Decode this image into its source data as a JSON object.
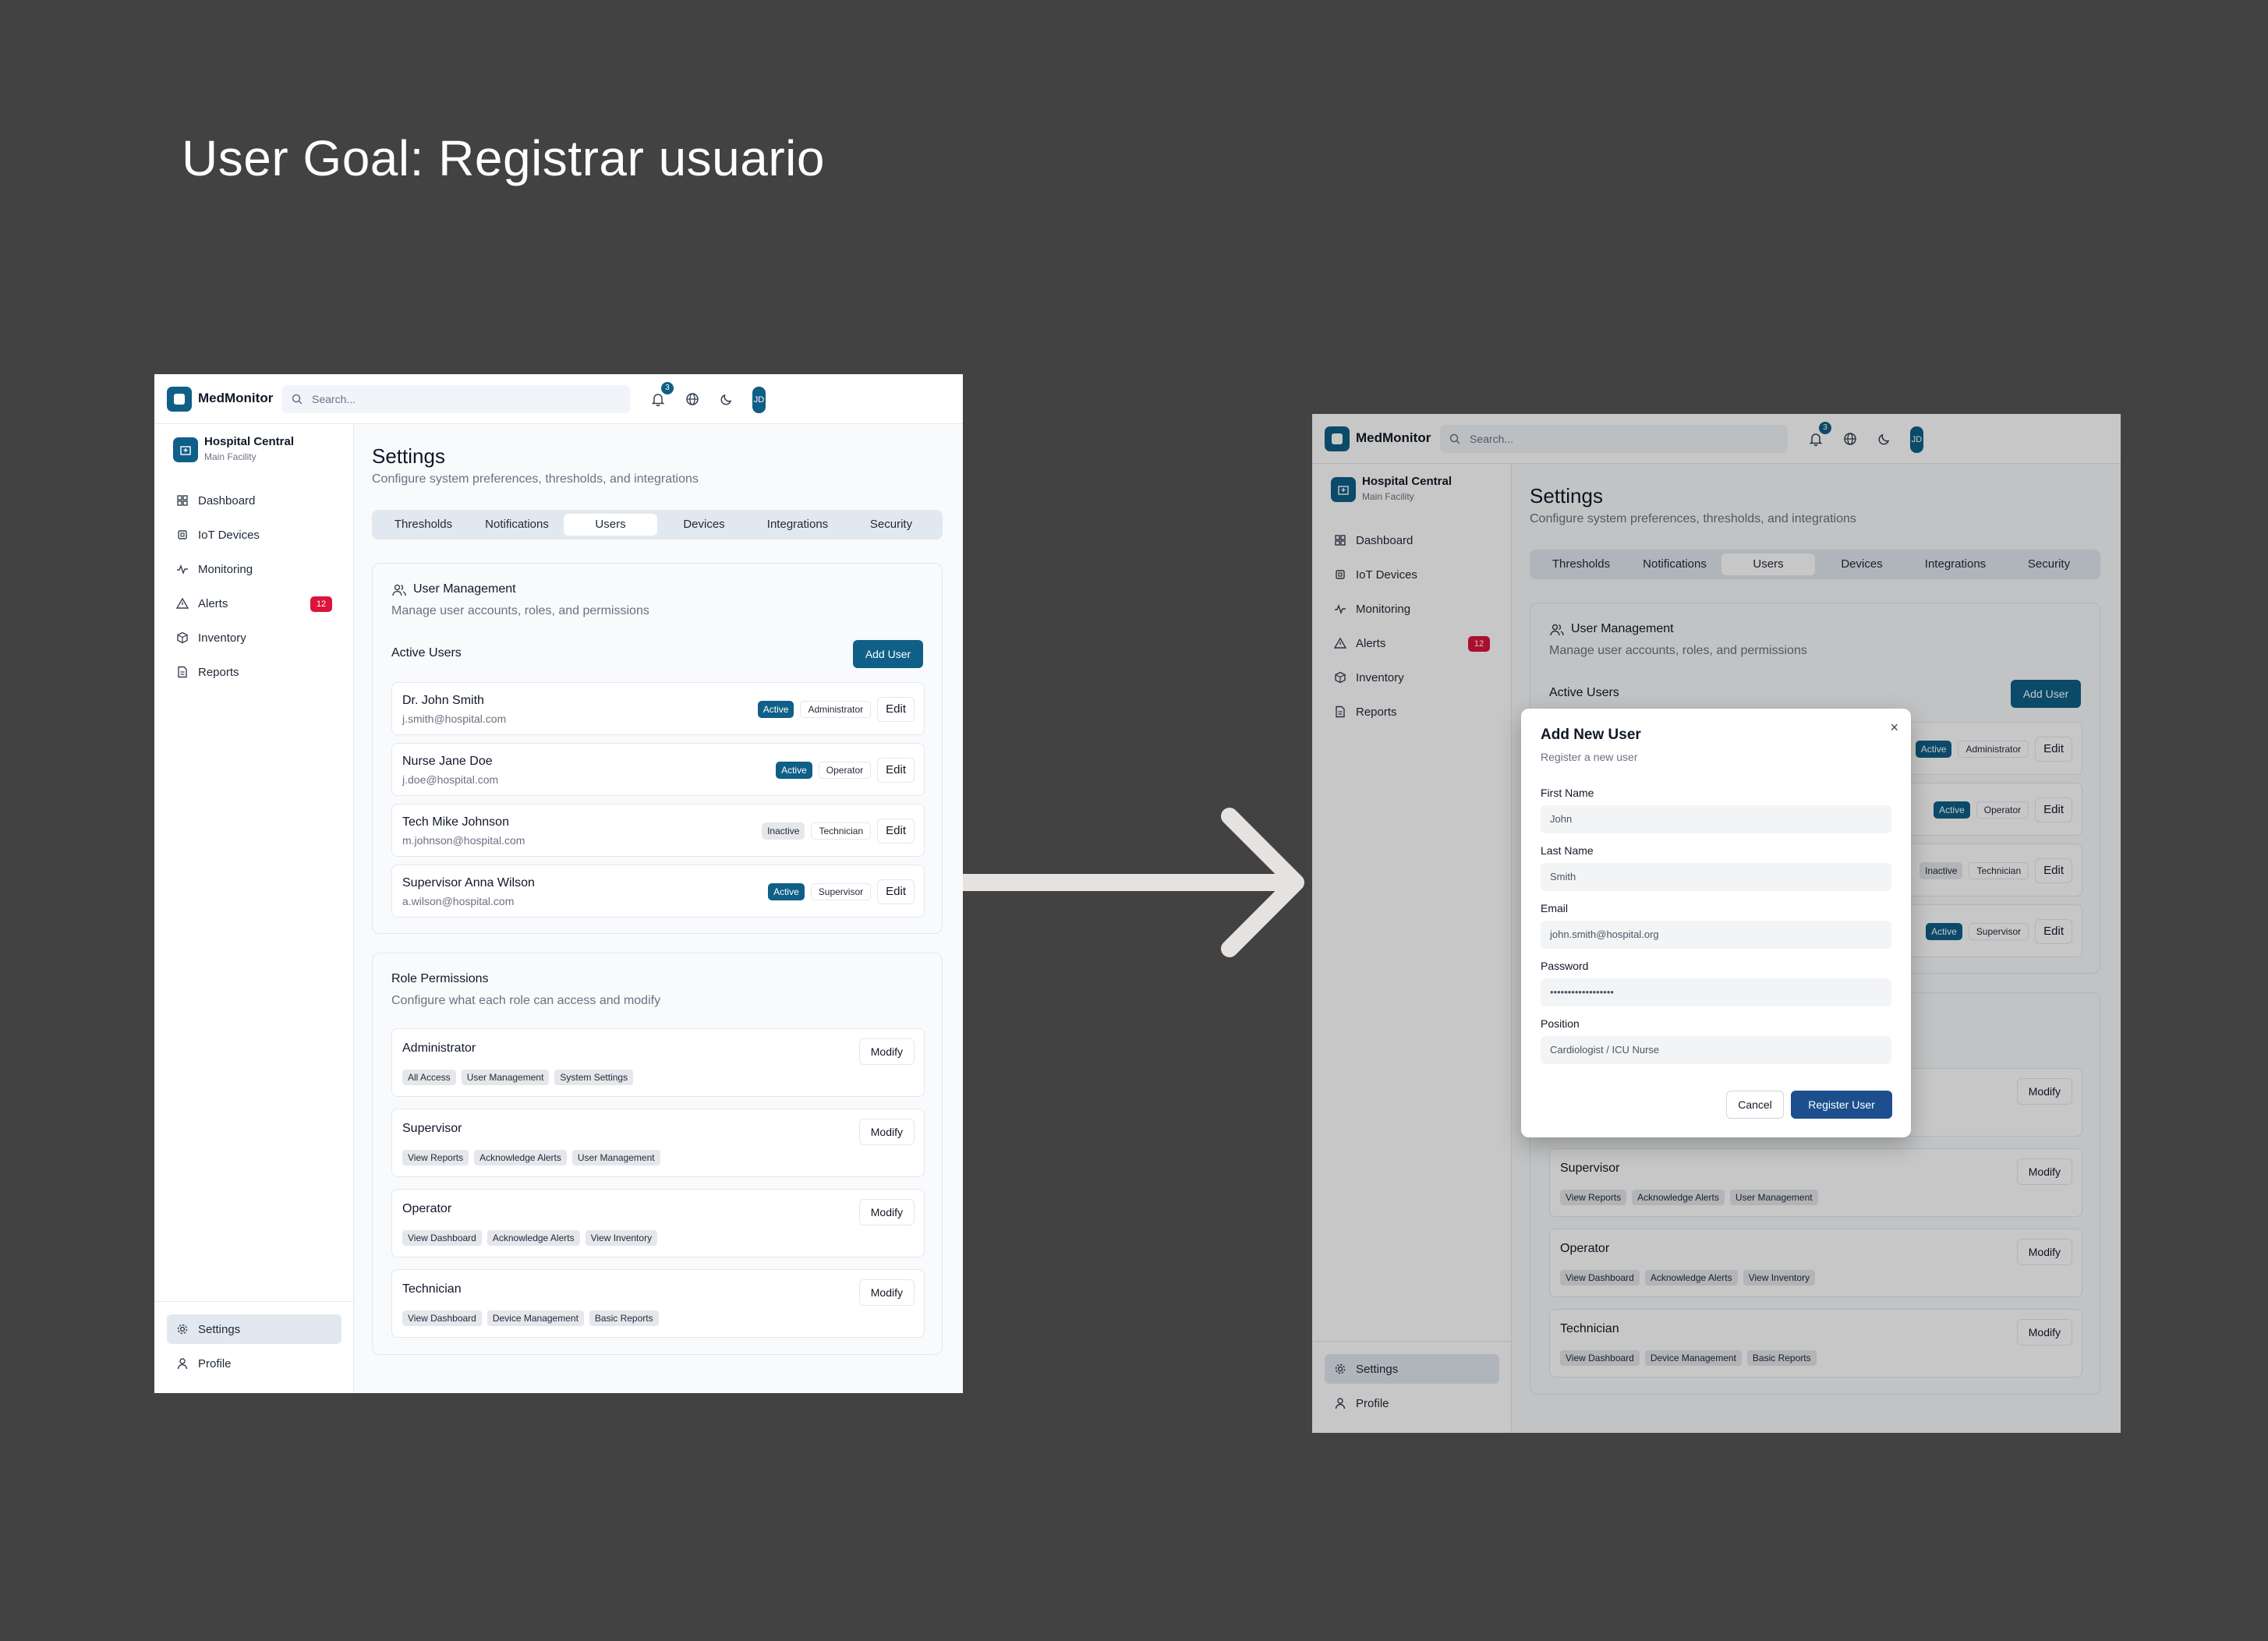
{
  "goal": "User Goal: Registrar usuario",
  "app": {
    "name": "MedMonitor",
    "search_placeholder": "Search...",
    "notification_count": "3",
    "avatar": "JD"
  },
  "facility": {
    "name": "Hospital Central",
    "sub": "Main Facility"
  },
  "nav": [
    {
      "label": "Dashboard",
      "icon": "grid-icon"
    },
    {
      "label": "IoT Devices",
      "icon": "chip-icon"
    },
    {
      "label": "Monitoring",
      "icon": "activity-icon"
    },
    {
      "label": "Alerts",
      "icon": "alert-triangle-icon",
      "badge": "12"
    },
    {
      "label": "Inventory",
      "icon": "box-icon"
    },
    {
      "label": "Reports",
      "icon": "file-icon"
    }
  ],
  "bottom_nav": [
    {
      "label": "Settings",
      "icon": "gear-icon"
    },
    {
      "label": "Profile",
      "icon": "user-icon"
    }
  ],
  "page": {
    "title": "Settings",
    "subtitle": "Configure system preferences, thresholds, and integrations"
  },
  "tabs": [
    "Thresholds",
    "Notifications",
    "Users",
    "Devices",
    "Integrations",
    "Security"
  ],
  "active_tab": "Users",
  "user_mgmt": {
    "title": "User Management",
    "subtitle": "Manage user accounts, roles, and permissions",
    "active_label": "Active Users",
    "add_button": "Add User",
    "edit_label": "Edit",
    "users": [
      {
        "name": "Dr. John Smith",
        "email": "j.smith@hospital.com",
        "status": "Active",
        "role": "Administrator"
      },
      {
        "name": "Nurse Jane Doe",
        "email": "j.doe@hospital.com",
        "status": "Active",
        "role": "Operator"
      },
      {
        "name": "Tech Mike Johnson",
        "email": "m.johnson@hospital.com",
        "status": "Inactive",
        "role": "Technician"
      },
      {
        "name": "Supervisor Anna Wilson",
        "email": "a.wilson@hospital.com",
        "status": "Active",
        "role": "Supervisor"
      }
    ]
  },
  "role_perms": {
    "title": "Role Permissions",
    "subtitle": "Configure what each role can access and modify",
    "modify_label": "Modify",
    "roles": [
      {
        "name": "Administrator",
        "perms": [
          "All Access",
          "User Management",
          "System Settings"
        ]
      },
      {
        "name": "Supervisor",
        "perms": [
          "View Reports",
          "Acknowledge Alerts",
          "User Management"
        ]
      },
      {
        "name": "Operator",
        "perms": [
          "View Dashboard",
          "Acknowledge Alerts",
          "View Inventory"
        ]
      },
      {
        "name": "Technician",
        "perms": [
          "View Dashboard",
          "Device Management",
          "Basic Reports"
        ]
      }
    ]
  },
  "modal": {
    "title": "Add New User",
    "subtitle": "Register a new user",
    "fields": [
      {
        "label": "First Name",
        "placeholder": "John"
      },
      {
        "label": "Last Name",
        "placeholder": "Smith"
      },
      {
        "label": "Email",
        "placeholder": "john.smith@hospital.org"
      },
      {
        "label": "Password",
        "placeholder": "••••••••••••••••••"
      },
      {
        "label": "Position",
        "placeholder": "Cardiologist / ICU Nurse"
      }
    ],
    "cancel": "Cancel",
    "submit": "Register User",
    "close": "×"
  },
  "colors": {
    "background": "#424242",
    "primary": "#0f5f87",
    "alert": "#dc143c",
    "submit": "#1d4f8f"
  }
}
